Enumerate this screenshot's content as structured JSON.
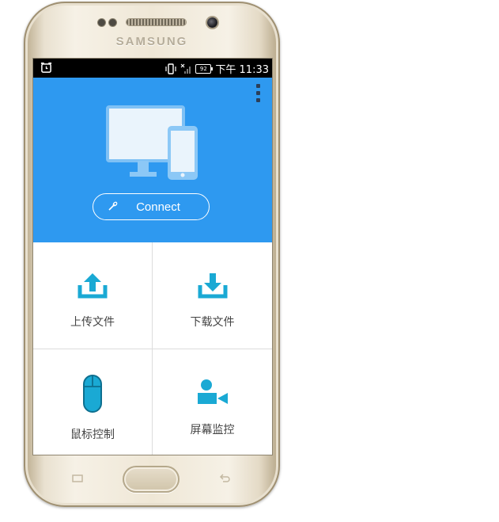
{
  "device": {
    "brand": "SAMSUNG"
  },
  "status_bar": {
    "time": "下午 11:33",
    "battery_text": "92"
  },
  "header": {
    "connect_label": "Connect"
  },
  "tiles": [
    {
      "label": "上传文件",
      "icon": "upload-icon"
    },
    {
      "label": "下载文件",
      "icon": "download-icon"
    },
    {
      "label": "鼠标控制",
      "icon": "mouse-icon"
    },
    {
      "label": "屏幕监控",
      "icon": "screen-monitor-icon"
    }
  ],
  "colors": {
    "header_blue": "#2e99f0",
    "icon_cyan": "#1aa9d4",
    "phone_gold": "#efe7d6"
  }
}
